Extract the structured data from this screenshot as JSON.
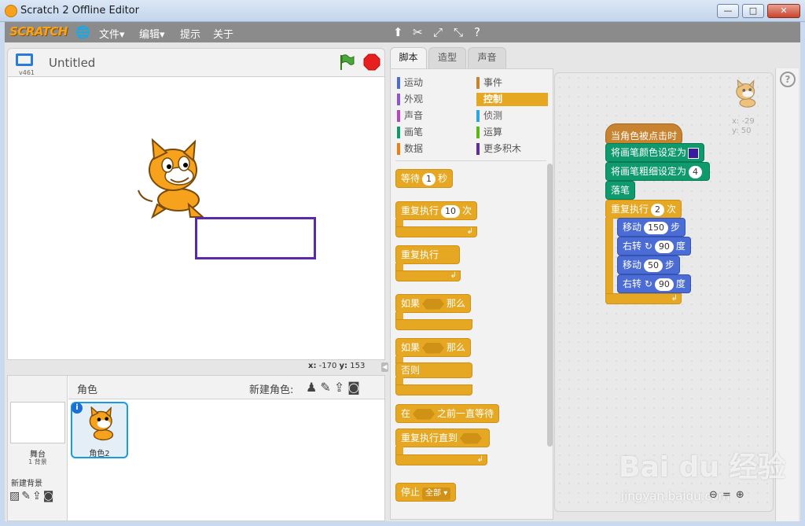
{
  "window": {
    "title": "Scratch 2 Offline Editor",
    "min": "—",
    "max": "□",
    "close": "✕"
  },
  "menubar": {
    "logo": "SCRATCH",
    "globe_icon": "globe-icon",
    "file": "文件▾",
    "edit": "编辑▾",
    "tips": "提示",
    "about": "关于",
    "tools": [
      "duplicate-icon",
      "cut-icon",
      "grow-icon",
      "shrink-icon",
      "help-icon"
    ]
  },
  "stage": {
    "version": "v461",
    "project_title": "Untitled",
    "x_label": "x:",
    "x_value": "-170",
    "y_label": "y:",
    "y_value": "153"
  },
  "sprites": {
    "title": "角色",
    "new_sprite_label": "新建角色:",
    "stage_label": "舞台",
    "stage_backdrops": "1 背景",
    "new_backdrop_label": "新建背景",
    "sprite_name": "角色2",
    "info": "i"
  },
  "tabs": {
    "scripts": "脚本",
    "costumes": "造型",
    "sounds": "声音"
  },
  "categories": [
    {
      "label": "运动",
      "color": "#4a6cd4"
    },
    {
      "label": "外观",
      "color": "#8a55d7"
    },
    {
      "label": "声音",
      "color": "#bb42c3"
    },
    {
      "label": "画笔",
      "color": "#0e9a6c"
    },
    {
      "label": "数据",
      "color": "#ee7d16"
    },
    {
      "label": "事件",
      "color": "#c88330"
    },
    {
      "label": "控制",
      "color": "#e6a822"
    },
    {
      "label": "侦测",
      "color": "#2ca5e2"
    },
    {
      "label": "运算",
      "color": "#5cb712"
    },
    {
      "label": "更多积木",
      "color": "#632d99"
    }
  ],
  "palette_blocks": {
    "wait": "等待",
    "wait_value": "1",
    "wait_unit": "秒",
    "repeat": "重复执行",
    "repeat_value": "10",
    "repeat_unit": "次",
    "forever": "重复执行",
    "if": "如果",
    "then": "那么",
    "if2": "如果",
    "then2": "那么",
    "else": "否则",
    "wait_until_pre": "在",
    "wait_until_post": "之前一直等待",
    "repeat_until": "重复执行直到",
    "stop": "停止",
    "stop_option": "全部"
  },
  "script": {
    "hat": "当角色被点击时",
    "pen_color": "将画笔颜色设定为",
    "pen_color_value": "#3a1a9e",
    "pen_size": "将画笔粗细设定为",
    "pen_size_value": "4",
    "pen_down": "落笔",
    "repeat": "重复执行",
    "repeat_value": "2",
    "repeat_unit": "次",
    "move1": "移动",
    "move1_value": "150",
    "move1_unit": "步",
    "turn1": "右转",
    "turn1_value": "90",
    "turn1_unit": "度",
    "move2": "移动",
    "move2_value": "50",
    "move2_unit": "步",
    "turn2": "右转",
    "turn2_value": "90",
    "turn2_unit": "度",
    "sprite_x": "x: -29",
    "sprite_y": "y: 50"
  },
  "watermark": {
    "big": "Bai du 经验",
    "small": "jingyan.baidu.com"
  }
}
